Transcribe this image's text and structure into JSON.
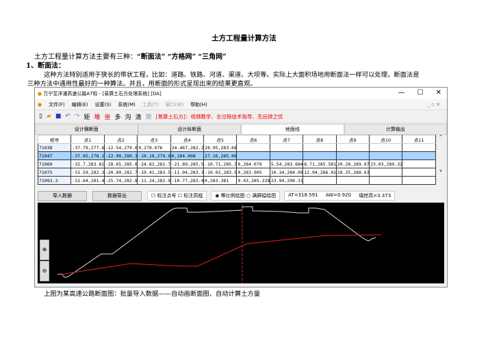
{
  "doc": {
    "title": "土方工程量计算方法",
    "intro": "土方工程量计算方法主要有三种：",
    "methods": [
      "“断面法”",
      "“方格网”",
      "“三角网”"
    ],
    "section": "1、断面法：",
    "para1": "这种方法特别适用于狭长的带状工程，比如：道路、铁路、河道、渠道、大坝等。实际上大面积场地用断面法一样可以处理，断面法是",
    "para2": "三种方法中通用性最好的一种算法。并且，用断面的形式呈现出来的结果更直观。",
    "caption": "上图为某高速公路断面图：批量导入数据——自动画断面图、自动计算土方量"
  },
  "app": {
    "title": "万宁至洋浦高速公路A7标 - [易算土石方处理系统] [DA]",
    "menu": [
      "文件(F)",
      "编辑(E)",
      "设置(S)",
      "系统(M)",
      "工具(T)",
      "窗口(W)",
      "帮助(H)"
    ],
    "toolbar_icons": [
      "new-icon",
      "open-icon",
      "save-icon",
      "undo-icon",
      "redo-icon"
    ],
    "toolbar_chars": [
      "矩",
      "堆",
      "坐",
      "多",
      "沟",
      "清",
      "荣"
    ],
    "promo": "[易算土石方]：视频教学、全过程技术指导、无后顾之忧",
    "tabs": [
      "设计横断面",
      "设计纵断面",
      "地面线",
      "计算输出"
    ],
    "active_tab": 2,
    "columns": [
      "桩号",
      "点1",
      "点2",
      "点3",
      "点4",
      "点5",
      "点6",
      "点7",
      "点8",
      "点9",
      "点10",
      "点11"
    ],
    "rows": [
      [
        "71038",
        "-37.79,277.6",
        "-12.54,279.6",
        "0,278.076",
        "24.467,282.2",
        "28.95,283.68",
        "",
        "",
        "",
        "",
        "",
        ""
      ],
      [
        "71047",
        "-37.05,278.1",
        "-22.90,280.3",
        "-10.18,279.9",
        "0,284.008",
        "27.16,285.08",
        "",
        "",
        "",
        "",
        "",
        ""
      ],
      [
        "71060",
        "-32.7,283.81",
        "-28.65,285.0",
        "-24.82,282.7",
        "-21.89,285.5",
        "-10.71,285.3",
        "0,284.079",
        "5.54,283.684",
        "8.71,285.581",
        "20.28,289.07",
        "23.03,289.32",
        ""
      ],
      [
        "71075",
        "-31.59,282.3",
        "-20.89,282.7",
        "-19.41,283.5",
        "-11.04,283.3",
        "-10.02,283.9",
        "0,283.905",
        "10.34,284.09",
        "12.94,286.02",
        "28.25,288.63",
        "",
        ""
      ],
      [
        "71093.3",
        "-31.64,281.4",
        "-25.74,282.8",
        "-11.24,282.9",
        "-10.77,283.4",
        "0,283.381",
        "9.43,285.228",
        "23.94,290.31",
        "",
        "",
        "",
        ""
      ]
    ],
    "selected_row": 1,
    "import_btn": "导入数据",
    "export_btn": "数据导出",
    "chk_point": "标注点号",
    "chk_elev": "标注高程",
    "radio_equal": "等比例绘图",
    "radio_full": "满屏幅绘图",
    "at": "AT=318.591",
    "aw": "AW=0.920",
    "fill_h": "填挖高=3.373"
  }
}
